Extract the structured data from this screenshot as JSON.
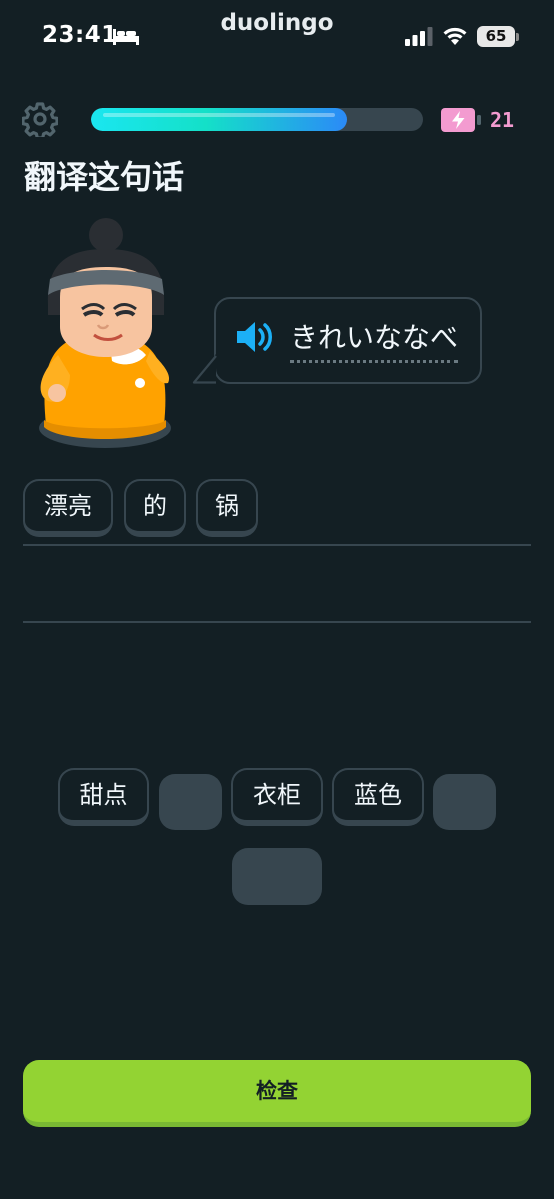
{
  "status_bar": {
    "time": "23:41",
    "app_name": "duolingo",
    "battery_level": "65"
  },
  "header": {
    "progress": 0.77,
    "energy_count": "21"
  },
  "title": "翻译这句话",
  "prompt": {
    "text": "きれいななべ"
  },
  "answer_tiles": [
    "漂亮",
    "的",
    "锅"
  ],
  "word_bank": [
    "甜点",
    "衣柜",
    "蓝色"
  ],
  "check_button": "检查",
  "colors": {
    "background": "#131f24",
    "progress_fill": "#2b8af7",
    "energy": "#f39bd0",
    "check_button": "#93d333",
    "character_dress": "#ffa200"
  }
}
